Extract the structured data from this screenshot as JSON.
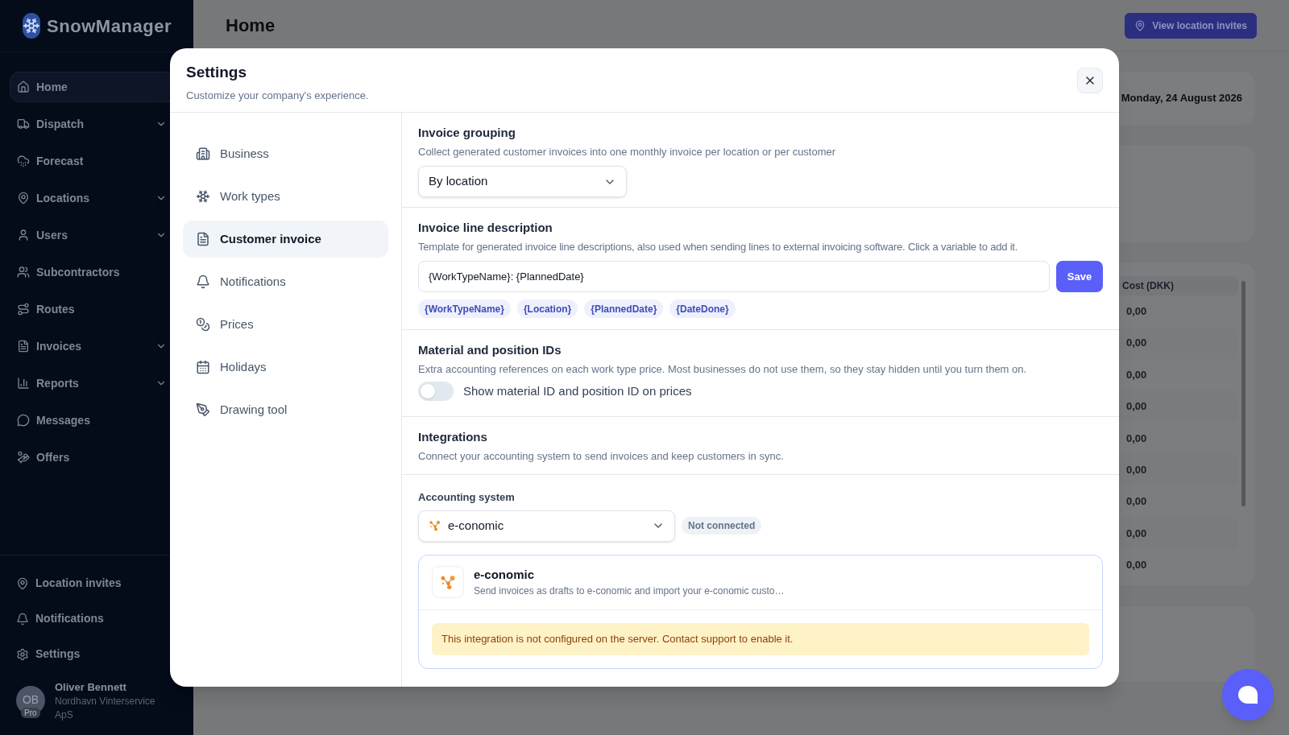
{
  "sidebar": {
    "brand": "SnowManager",
    "items": [
      {
        "label": "Home",
        "selected": true,
        "expandable": false
      },
      {
        "label": "Dispatch",
        "selected": false,
        "expandable": true
      },
      {
        "label": "Forecast",
        "selected": false,
        "expandable": false
      },
      {
        "label": "Locations",
        "selected": false,
        "expandable": true
      },
      {
        "label": "Users",
        "selected": false,
        "expandable": true
      },
      {
        "label": "Subcontractors",
        "selected": false,
        "expandable": false
      },
      {
        "label": "Routes",
        "selected": false,
        "expandable": false
      },
      {
        "label": "Invoices",
        "selected": false,
        "expandable": true
      },
      {
        "label": "Reports",
        "selected": false,
        "expandable": true
      },
      {
        "label": "Messages",
        "selected": false,
        "expandable": false
      },
      {
        "label": "Offers",
        "selected": false,
        "expandable": false
      }
    ],
    "bottom_items": [
      "Location invites",
      "Notifications",
      "Settings"
    ],
    "user": {
      "initials": "OB",
      "plan": "Pro",
      "name": "Oliver Bennett",
      "company": "Nordhavn Vinterservice ApS"
    }
  },
  "header": {
    "title": "Home",
    "button": "View location invites"
  },
  "background": {
    "date": "Monday, 24 August 2026",
    "table": {
      "column": "Cost (DKK)",
      "rows": [
        "0,00",
        "0,00",
        "0,00",
        "0,00",
        "0,00",
        "0,00",
        "0,00",
        "0,00",
        "0,00"
      ]
    }
  },
  "modal": {
    "title": "Settings",
    "subtitle": "Customize your company's experience.",
    "nav": [
      {
        "label": "Business",
        "selected": false
      },
      {
        "label": "Work types",
        "selected": false
      },
      {
        "label": "Customer invoice",
        "selected": true
      },
      {
        "label": "Notifications",
        "selected": false
      },
      {
        "label": "Prices",
        "selected": false
      },
      {
        "label": "Holidays",
        "selected": false
      },
      {
        "label": "Drawing tool",
        "selected": false
      }
    ],
    "invoice_grouping": {
      "title": "Invoice grouping",
      "description": "Collect generated customer invoices into one monthly invoice per location or per customer",
      "value": "By location"
    },
    "invoice_line": {
      "title": "Invoice line description",
      "description": "Template for generated invoice line descriptions, also used when sending lines to external invoicing software. Click a variable to add it.",
      "value": "{WorkTypeName}: {PlannedDate}",
      "save": "Save",
      "variables": [
        "{WorkTypeName}",
        "{Location}",
        "{PlannedDate}",
        "{DateDone}"
      ]
    },
    "material_ids": {
      "title": "Material and position IDs",
      "description": "Extra accounting references on each work type price. Most businesses do not use them, so they stay hidden until you turn them on.",
      "toggle": {
        "label": "Show material ID and position ID on prices",
        "on": false
      }
    },
    "integrations": {
      "title": "Integrations",
      "description": "Connect your accounting system to send invoices and keep customers in sync."
    },
    "accounting": {
      "label": "Accounting system",
      "value": "e-conomic",
      "status": "Not connected",
      "card": {
        "name": "e-conomic",
        "description": "Send invoices as drafts to e-conomic and import your e-conomic custo…",
        "warning": "This integration is not configured on the server. Contact support to enable it."
      }
    }
  }
}
